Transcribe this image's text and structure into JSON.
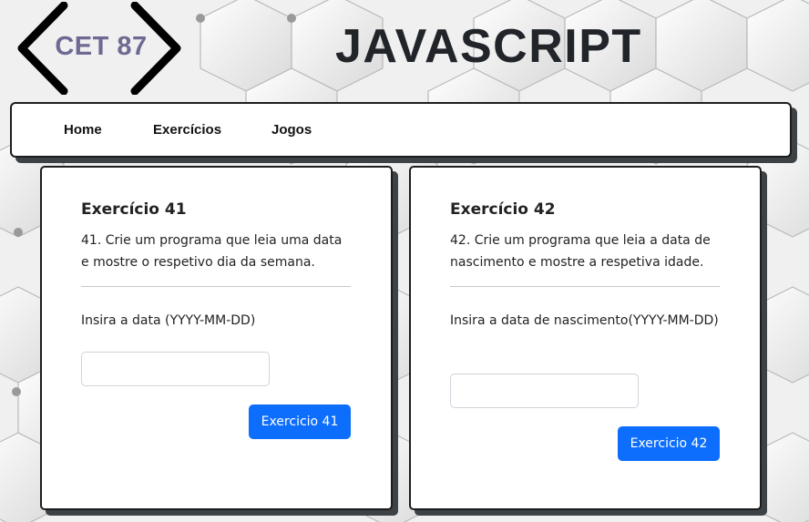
{
  "header": {
    "logo_text": "CET 87",
    "title": "JAVASCRIPT"
  },
  "navbar": {
    "links": [
      "Home",
      "Exercícios",
      "Jogos"
    ]
  },
  "exercises": [
    {
      "title": "Exercício 41",
      "description": "41. Crie um programa que leia uma data e mostre o respetivo dia da semana.",
      "input_label": "Insira a data (YYYY-MM-DD)",
      "input_value": "",
      "button_label": "Exercicio 41"
    },
    {
      "title": "Exercício 42",
      "description": "42. Crie um programa que leia a data de nascimento e mostre a respetiva idade.",
      "input_label": "Insira a data de nascimento(YYYY-MM-DD)",
      "input_value": "",
      "button_label": "Exercicio 42"
    }
  ],
  "colors": {
    "primary_button": "#0d6efd",
    "title_text": "#212529",
    "logo_text": "#6d6a93",
    "card_shadow": "#3d4246"
  }
}
